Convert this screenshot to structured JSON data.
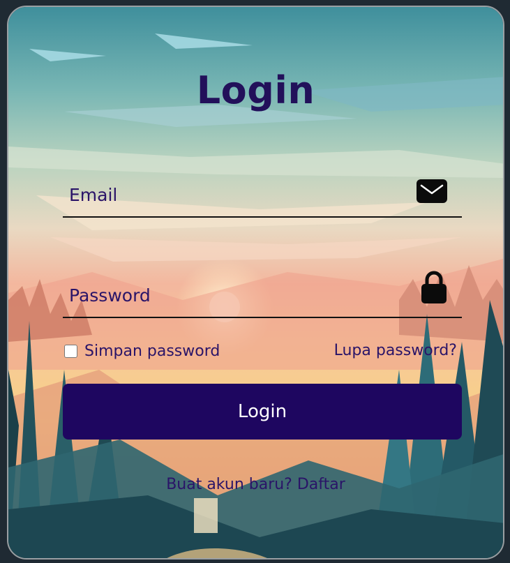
{
  "form": {
    "title": "Login",
    "email": {
      "label": "Email",
      "icon": "envelope-icon"
    },
    "password": {
      "label": "Password",
      "icon": "lock-icon"
    },
    "remember": {
      "label": "Simpan password",
      "checked": false
    },
    "forgot_link": "Lupa password?",
    "submit_label": "Login",
    "signup_text": "Buat akun baru? Daftar"
  },
  "colors": {
    "title": "#22105a",
    "text": "#2a1468",
    "button_bg": "#1e0660",
    "button_text": "#ffffff",
    "underline": "#111111"
  }
}
